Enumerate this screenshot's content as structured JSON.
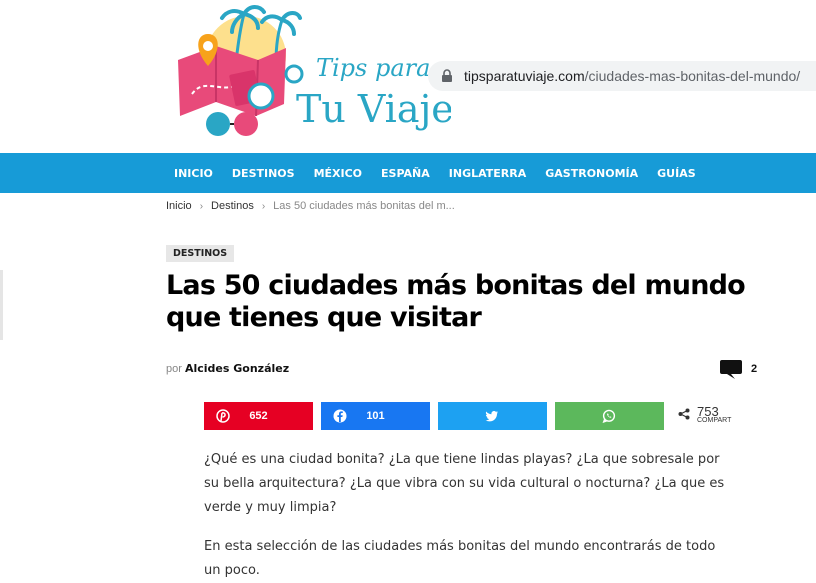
{
  "browser": {
    "url_host": "tipsparatuviaje.com",
    "url_path": "/ciudades-mas-bonitas-del-mundo/"
  },
  "logo": {
    "line1": "Tips para",
    "line2": "Tu Viaje"
  },
  "nav": {
    "items": [
      "INICIO",
      "DESTINOS",
      "MÉXICO",
      "ESPAÑA",
      "INGLATERRA",
      "GASTRONOMÍA",
      "GUÍAS"
    ]
  },
  "breadcrumb": {
    "home": "Inicio",
    "section": "Destinos",
    "current": "Las 50 ciudades más bonitas del m..."
  },
  "article": {
    "category": "DESTINOS",
    "title": "Las 50 ciudades más bonitas del mundo que tienes que visitar",
    "by_prefix": "por",
    "author": "Alcides González",
    "comment_count": "2",
    "paragraphs": [
      "¿Qué es una ciudad bonita? ¿La que tiene lindas playas? ¿La que sobresale por su bella arquitectura? ¿La que vibra con su vida cultural o nocturna? ¿La que es verde y muy limpia?",
      "En esta selección de las ciudades más bonitas del mundo encontrarás de todo un poco."
    ]
  },
  "share": {
    "pinterest": "652",
    "facebook": "101",
    "total": "753",
    "total_label": "COMPART",
    "colors": {
      "pinterest": "#e60023",
      "facebook": "#1877f2",
      "twitter": "#1da1f2",
      "whatsapp": "#5cb85c"
    }
  },
  "colors": {
    "nav_bg": "#179bd7",
    "logo_teal": "#2aa6c5",
    "logo_pink": "#e84a7a"
  }
}
